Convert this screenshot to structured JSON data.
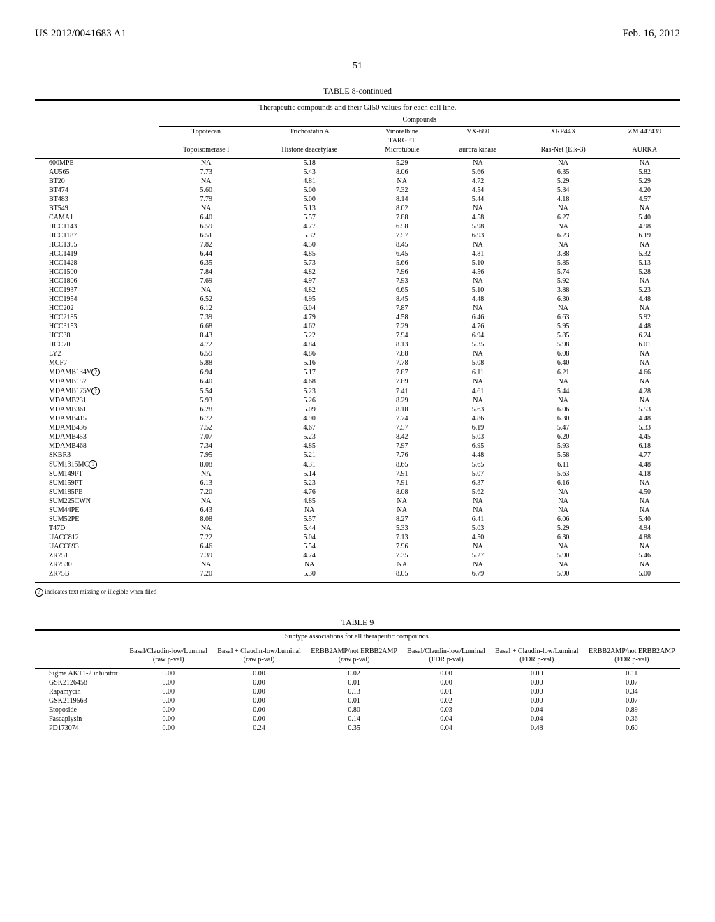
{
  "header": {
    "left": "US 2012/0041683 A1",
    "right": "Feb. 16, 2012"
  },
  "page_number": "51",
  "table8": {
    "title": "TABLE 8-continued",
    "subtitle": "Therapeutic compounds and their GI50 values for each cell line.",
    "compounds_label": "Compounds",
    "compound_cols": [
      "Topotecan",
      "Trichostatin A",
      "Vinorelbine",
      "VX-680",
      "XRP44X",
      "ZM 447439"
    ],
    "target_label": "TARGET",
    "target_cols": [
      "Topoisomerase I",
      "Histone deacetylase",
      "Microtubule",
      "aurora kinase",
      "Ras-Net (Elk-3)",
      "AURKA"
    ],
    "rows": [
      {
        "label": "600MPE",
        "marker": "",
        "v": [
          "NA",
          "5.18",
          "5.29",
          "NA",
          "NA",
          "NA"
        ]
      },
      {
        "label": "AU565",
        "marker": "",
        "v": [
          "7.73",
          "5.43",
          "8.06",
          "5.66",
          "6.35",
          "5.82"
        ]
      },
      {
        "label": "BT20",
        "marker": "",
        "v": [
          "NA",
          "4.81",
          "NA",
          "4.72",
          "5.29",
          "5.29"
        ]
      },
      {
        "label": "BT474",
        "marker": "",
        "v": [
          "5.60",
          "5.00",
          "7.32",
          "4.54",
          "5.34",
          "4.20"
        ]
      },
      {
        "label": "BT483",
        "marker": "",
        "v": [
          "7.79",
          "5.00",
          "8.14",
          "5.44",
          "4.18",
          "4.57"
        ]
      },
      {
        "label": "BT549",
        "marker": "",
        "v": [
          "NA",
          "5.13",
          "8.02",
          "NA",
          "NA",
          "NA"
        ]
      },
      {
        "label": "CAMA1",
        "marker": "",
        "v": [
          "6.40",
          "5.57",
          "7.88",
          "4.58",
          "6.27",
          "5.40"
        ]
      },
      {
        "label": "HCC1143",
        "marker": "",
        "v": [
          "6.59",
          "4.77",
          "6.58",
          "5.98",
          "NA",
          "4.98"
        ]
      },
      {
        "label": "HCC1187",
        "marker": "",
        "v": [
          "6.51",
          "5.32",
          "7.57",
          "6.93",
          "6.23",
          "6.19"
        ]
      },
      {
        "label": "HCC1395",
        "marker": "",
        "v": [
          "7.82",
          "4.50",
          "8.45",
          "NA",
          "NA",
          "NA"
        ]
      },
      {
        "label": "HCC1419",
        "marker": "",
        "v": [
          "6.44",
          "4.85",
          "6.45",
          "4.81",
          "3.88",
          "5.32"
        ]
      },
      {
        "label": "HCC1428",
        "marker": "",
        "v": [
          "6.35",
          "5.73",
          "5.66",
          "5.10",
          "5.85",
          "5.13"
        ]
      },
      {
        "label": "HCC1500",
        "marker": "",
        "v": [
          "7.84",
          "4.82",
          "7.96",
          "4.56",
          "5.74",
          "5.28"
        ]
      },
      {
        "label": "HCC1806",
        "marker": "",
        "v": [
          "7.69",
          "4.97",
          "7.93",
          "NA",
          "5.92",
          "NA"
        ]
      },
      {
        "label": "HCC1937",
        "marker": "",
        "v": [
          "NA",
          "4.82",
          "6.65",
          "5.10",
          "3.88",
          "5.23"
        ]
      },
      {
        "label": "HCC1954",
        "marker": "",
        "v": [
          "6.52",
          "4.95",
          "8.45",
          "4.48",
          "6.30",
          "4.48"
        ]
      },
      {
        "label": "HCC202",
        "marker": "",
        "v": [
          "6.12",
          "6.04",
          "7.87",
          "NA",
          "NA",
          "NA"
        ]
      },
      {
        "label": "HCC2185",
        "marker": "",
        "v": [
          "7.39",
          "4.79",
          "4.58",
          "6.46",
          "6.63",
          "5.92"
        ]
      },
      {
        "label": "HCC3153",
        "marker": "",
        "v": [
          "6.68",
          "4.62",
          "7.29",
          "4.76",
          "5.95",
          "4.48"
        ]
      },
      {
        "label": "HCC38",
        "marker": "",
        "v": [
          "8.43",
          "5.22",
          "7.94",
          "6.94",
          "5.85",
          "6.24"
        ]
      },
      {
        "label": "HCC70",
        "marker": "",
        "v": [
          "4.72",
          "4.84",
          "8.13",
          "5.35",
          "5.98",
          "6.01"
        ]
      },
      {
        "label": "LY2",
        "marker": "",
        "v": [
          "6.59",
          "4.86",
          "7.88",
          "NA",
          "6.08",
          "NA"
        ]
      },
      {
        "label": "MCF7",
        "marker": "",
        "v": [
          "5.88",
          "5.16",
          "7.78",
          "5.08",
          "6.40",
          "NA"
        ]
      },
      {
        "label": "MDAMB134V",
        "marker": "?",
        "v": [
          "6.94",
          "5.17",
          "7.87",
          "6.11",
          "6.21",
          "4.66"
        ]
      },
      {
        "label": "MDAMB157",
        "marker": "",
        "v": [
          "6.40",
          "4.68",
          "7.89",
          "NA",
          "NA",
          "NA"
        ]
      },
      {
        "label": "MDAMB175V",
        "marker": "?",
        "v": [
          "5.54",
          "5.23",
          "7.41",
          "4.61",
          "5.44",
          "4.28"
        ]
      },
      {
        "label": "MDAMB231",
        "marker": "",
        "v": [
          "5.93",
          "5.26",
          "8.29",
          "NA",
          "NA",
          "NA"
        ]
      },
      {
        "label": "MDAMB361",
        "marker": "",
        "v": [
          "6.28",
          "5.09",
          "8.18",
          "5.63",
          "6.06",
          "5.53"
        ]
      },
      {
        "label": "MDAMB415",
        "marker": "",
        "v": [
          "6.72",
          "4.90",
          "7.74",
          "4.86",
          "6.30",
          "4.48"
        ]
      },
      {
        "label": "MDAMB436",
        "marker": "",
        "v": [
          "7.52",
          "4.67",
          "7.57",
          "6.19",
          "5.47",
          "5.33"
        ]
      },
      {
        "label": "MDAMB453",
        "marker": "",
        "v": [
          "7.07",
          "5.23",
          "8.42",
          "5.03",
          "6.20",
          "4.45"
        ]
      },
      {
        "label": "MDAMB468",
        "marker": "",
        "v": [
          "7.34",
          "4.85",
          "7.97",
          "6.95",
          "5.93",
          "6.18"
        ]
      },
      {
        "label": "SKBR3",
        "marker": "",
        "v": [
          "7.95",
          "5.21",
          "7.76",
          "4.48",
          "5.58",
          "4.77"
        ]
      },
      {
        "label": "SUM1315MC",
        "marker": "?",
        "v": [
          "8.08",
          "4.31",
          "8.65",
          "5.65",
          "6.11",
          "4.48"
        ]
      },
      {
        "label": "SUM149PT",
        "marker": "",
        "v": [
          "NA",
          "5.14",
          "7.91",
          "5.07",
          "5.63",
          "4.18"
        ]
      },
      {
        "label": "SUM159PT",
        "marker": "",
        "v": [
          "6.13",
          "5.23",
          "7.91",
          "6.37",
          "6.16",
          "NA"
        ]
      },
      {
        "label": "SUM185PE",
        "marker": "",
        "v": [
          "7.20",
          "4.76",
          "8.08",
          "5.62",
          "NA",
          "4.50"
        ]
      },
      {
        "label": "SUM225CWN",
        "marker": "",
        "v": [
          "NA",
          "4.85",
          "NA",
          "NA",
          "NA",
          "NA"
        ]
      },
      {
        "label": "SUM44PE",
        "marker": "",
        "v": [
          "6.43",
          "NA",
          "NA",
          "NA",
          "NA",
          "NA"
        ]
      },
      {
        "label": "SUM52PE",
        "marker": "",
        "v": [
          "8.08",
          "5.57",
          "8.27",
          "6.41",
          "6.06",
          "5.40"
        ]
      },
      {
        "label": "T47D",
        "marker": "",
        "v": [
          "NA",
          "5.44",
          "5.33",
          "5.03",
          "5.29",
          "4.94"
        ]
      },
      {
        "label": "UACC812",
        "marker": "",
        "v": [
          "7.22",
          "5.04",
          "7.13",
          "4.50",
          "6.30",
          "4.88"
        ]
      },
      {
        "label": "UACC893",
        "marker": "",
        "v": [
          "6.46",
          "5.54",
          "7.96",
          "NA",
          "NA",
          "NA"
        ]
      },
      {
        "label": "ZR751",
        "marker": "",
        "v": [
          "7.39",
          "4.74",
          "7.35",
          "5.27",
          "5.90",
          "5.46"
        ]
      },
      {
        "label": "ZR7530",
        "marker": "",
        "v": [
          "NA",
          "NA",
          "NA",
          "NA",
          "NA",
          "NA"
        ]
      },
      {
        "label": "ZR75B",
        "marker": "",
        "v": [
          "7.20",
          "5.30",
          "8.05",
          "6.79",
          "5.90",
          "5.00"
        ]
      }
    ],
    "footnote_marker": "?",
    "footnote_text": " indicates text missing or illegible when filed"
  },
  "table9": {
    "title": "TABLE 9",
    "subtitle": "Subtype associations for all therapeutic compounds.",
    "headers": [
      "Basal/Claudin-low/Luminal (raw p-val)",
      "Basal + Claudin-low/Luminal (raw p-val)",
      "ERBB2AMP/not ERBB2AMP (raw p-val)",
      "Basal/Claudin-low/Luminal (FDR p-val)",
      "Basal + Claudin-low/Luminal (FDR p-val)",
      "ERBB2AMP/not ERBB2AMP (FDR p-val)"
    ],
    "rows": [
      {
        "label": "Sigma AKT1-2 inhibitor",
        "v": [
          "0.00",
          "0.00",
          "0.02",
          "0.00",
          "0.00",
          "0.11"
        ]
      },
      {
        "label": "GSK2126458",
        "v": [
          "0.00",
          "0.00",
          "0.01",
          "0.00",
          "0.00",
          "0.07"
        ]
      },
      {
        "label": "Rapamycin",
        "v": [
          "0.00",
          "0.00",
          "0.13",
          "0.01",
          "0.00",
          "0.34"
        ]
      },
      {
        "label": "GSK2119563",
        "v": [
          "0.00",
          "0.00",
          "0.01",
          "0.02",
          "0.00",
          "0.07"
        ]
      },
      {
        "label": "Etoposide",
        "v": [
          "0.00",
          "0.00",
          "0.80",
          "0.03",
          "0.04",
          "0.89"
        ]
      },
      {
        "label": "Fascaplysin",
        "v": [
          "0.00",
          "0.00",
          "0.14",
          "0.04",
          "0.04",
          "0.36"
        ]
      },
      {
        "label": "PD173074",
        "v": [
          "0.00",
          "0.24",
          "0.35",
          "0.04",
          "0.48",
          "0.60"
        ]
      }
    ]
  }
}
